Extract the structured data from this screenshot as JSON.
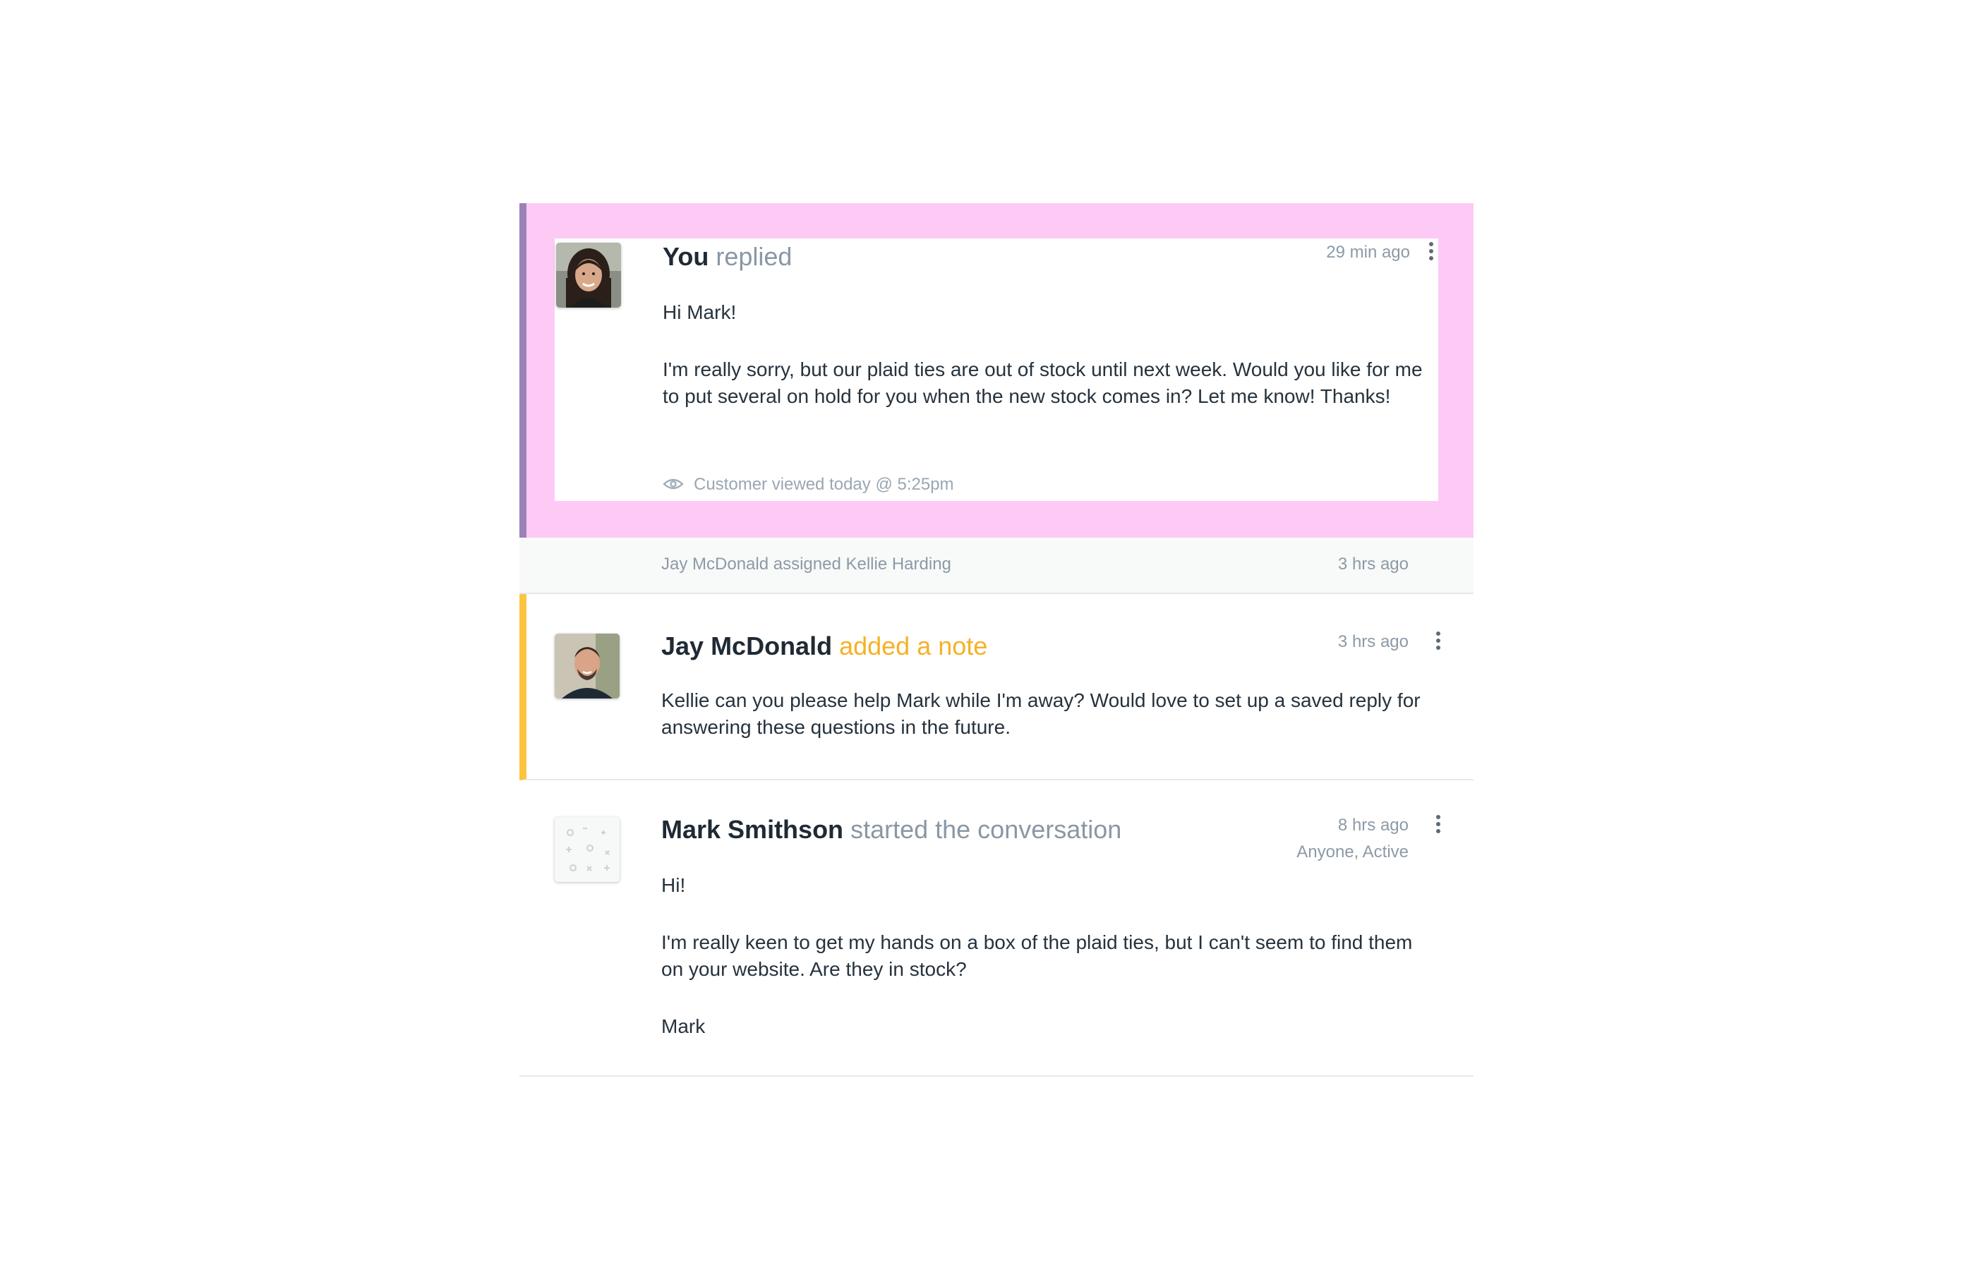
{
  "thread": {
    "reply": {
      "author": "You",
      "action": "replied",
      "time": "29 min ago",
      "paragraphs": [
        "Hi Mark!",
        "I'm really sorry, but our plaid ties are out of stock until next week. Would you like for me to put several on hold for you when the new stock comes in? Let me know! Thanks!"
      ],
      "viewed": "Customer viewed today @ 5:25pm",
      "highlight_color": "#fdcaf5",
      "accent_color": "#9b82b6"
    },
    "assignment": {
      "text": "Jay McDonald assigned Kellie Harding",
      "time": "3 hrs ago"
    },
    "note": {
      "author": "Jay McDonald",
      "action": "added a note",
      "time": "3 hrs ago",
      "paragraphs": [
        "Kellie can you please help Mark while I'm away? Would love to set up a saved reply for answering these questions in the future."
      ],
      "accent_color": "#fcc43f",
      "action_color": "#f5b126"
    },
    "start": {
      "author": "Mark Smithson",
      "action": "started the conversation",
      "time": "8 hrs ago",
      "status": "Anyone, Active",
      "paragraphs": [
        "Hi!",
        "I'm really keen to get my hands on a box of the plaid ties, but I can't seem to find them on your website. Are they in stock?",
        "Mark"
      ]
    }
  },
  "icons": {
    "menu": "more-vertical-icon",
    "viewed": "eye-icon"
  }
}
